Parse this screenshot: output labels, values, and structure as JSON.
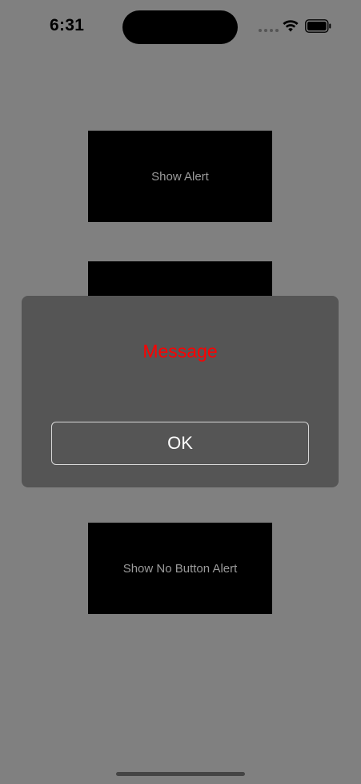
{
  "status_bar": {
    "time": "6:31",
    "icons": [
      "signal-dots-icon",
      "wifi-icon",
      "battery-icon"
    ]
  },
  "buttons": {
    "show_alert": "Show Alert",
    "second_button": "",
    "show_no_button_alert": "Show No Button Alert"
  },
  "alert": {
    "message": "Message",
    "ok_label": "OK"
  },
  "colors": {
    "background": "#808080",
    "button_bg": "#000000",
    "button_text": "#9b9b9b",
    "alert_bg": "#555555",
    "message": "#ff0000"
  }
}
